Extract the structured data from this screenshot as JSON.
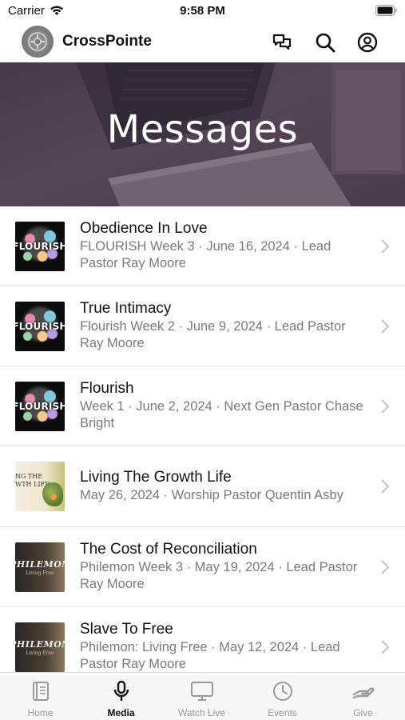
{
  "status_bar": {
    "carrier": "Carrier",
    "time": "9:58 PM"
  },
  "header": {
    "app_name": "CrossPointe"
  },
  "hero": {
    "title": "Messages"
  },
  "messages": [
    {
      "title": "Obedience In Love",
      "subtitle": "FLOURISH Week 3 · June 16, 2024 · Lead Pastor Ray Moore",
      "thumb_text": "FLOURISH"
    },
    {
      "title": "True Intimacy",
      "subtitle": "Flourish Week 2 · June 9, 2024 · Lead Pastor Ray Moore",
      "thumb_text": "FLOURISH"
    },
    {
      "title": "Flourish",
      "subtitle": "Week 1 · June 2, 2024 · Next Gen Pastor Chase Bright",
      "thumb_text": "FLOURISH"
    },
    {
      "title": "Living The Growth Life",
      "subtitle": "May 26, 2024 · Worship Pastor Quentin Asby",
      "thumb_text_1": "NG THE",
      "thumb_text_2": "WTH LIFE"
    },
    {
      "title": "The Cost of Reconciliation",
      "subtitle": "Philemon Week 3 · May 19, 2024 · Lead Pastor Ray Moore",
      "thumb_text": "PHILEMON",
      "thumb_sub": "Living Free"
    },
    {
      "title": "Slave To Free",
      "subtitle": "Philemon: Living Free · May 12, 2024 · Lead Pastor Ray Moore",
      "thumb_text": "PHILEMON",
      "thumb_sub": "Living Free"
    }
  ],
  "tabs": [
    {
      "label": "Home",
      "icon": "book-icon"
    },
    {
      "label": "Media",
      "icon": "microphone-icon"
    },
    {
      "label": "Watch Live",
      "icon": "monitor-icon"
    },
    {
      "label": "Events",
      "icon": "clock-icon"
    },
    {
      "label": "Give",
      "icon": "hand-icon"
    }
  ],
  "active_tab": "Media",
  "colors": {
    "hero_overlay": "#4f4150",
    "text_primary": "#111111",
    "text_secondary": "#7a7a7a",
    "tab_inactive": "#9a9a9a"
  }
}
